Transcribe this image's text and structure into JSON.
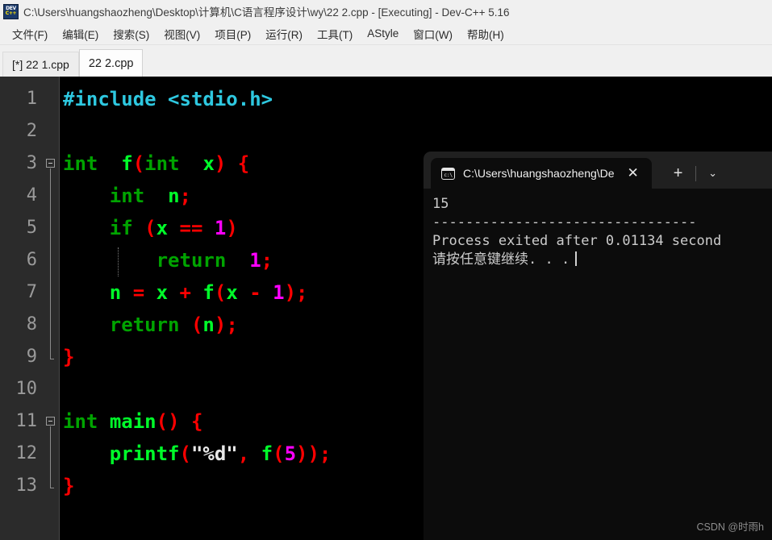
{
  "window": {
    "title": "C:\\Users\\huangshaozheng\\Desktop\\计算机\\C语言程序设计\\wy\\22 2.cpp - [Executing] - Dev-C++ 5.16",
    "icon_dev": "DEV",
    "icon_cpp": "C++"
  },
  "menubar": {
    "items": [
      {
        "label": "文件(F)"
      },
      {
        "label": "编辑(E)"
      },
      {
        "label": "搜索(S)"
      },
      {
        "label": "视图(V)"
      },
      {
        "label": "项目(P)"
      },
      {
        "label": "运行(R)"
      },
      {
        "label": "工具(T)"
      },
      {
        "label": "AStyle"
      },
      {
        "label": "窗口(W)"
      },
      {
        "label": "帮助(H)"
      }
    ]
  },
  "editor_tabs": [
    {
      "label": "[*] 22 1.cpp",
      "active": false
    },
    {
      "label": "22 2.cpp",
      "active": true
    }
  ],
  "editor": {
    "line_numbers": [
      "1",
      "2",
      "3",
      "4",
      "5",
      "6",
      "7",
      "8",
      "9",
      "10",
      "11",
      "12",
      "13"
    ],
    "lines": [
      {
        "n": "1",
        "tokens": [
          {
            "t": "#include ",
            "c": "pre"
          },
          {
            "t": "<stdio.h>",
            "c": "pre"
          }
        ]
      },
      {
        "n": "2",
        "tokens": []
      },
      {
        "n": "3",
        "tokens": [
          {
            "t": "int",
            "c": "kw"
          },
          {
            "t": "  ",
            "c": "op"
          },
          {
            "t": "f",
            "c": "id"
          },
          {
            "t": "(",
            "c": "op"
          },
          {
            "t": "int",
            "c": "kw"
          },
          {
            "t": "  ",
            "c": "op"
          },
          {
            "t": "x",
            "c": "id"
          },
          {
            "t": ")",
            "c": "op"
          },
          {
            "t": " ",
            "c": "op"
          },
          {
            "t": "{",
            "c": "op"
          }
        ]
      },
      {
        "n": "4",
        "tokens": [
          {
            "t": "    ",
            "c": "op"
          },
          {
            "t": "int",
            "c": "kw"
          },
          {
            "t": "  ",
            "c": "op"
          },
          {
            "t": "n",
            "c": "id"
          },
          {
            "t": ";",
            "c": "op"
          }
        ]
      },
      {
        "n": "5",
        "tokens": [
          {
            "t": "    ",
            "c": "op"
          },
          {
            "t": "if",
            "c": "kw"
          },
          {
            "t": " ",
            "c": "op"
          },
          {
            "t": "(",
            "c": "op"
          },
          {
            "t": "x",
            "c": "id"
          },
          {
            "t": " ",
            "c": "op"
          },
          {
            "t": "==",
            "c": "op"
          },
          {
            "t": " ",
            "c": "op"
          },
          {
            "t": "1",
            "c": "num"
          },
          {
            "t": ")",
            "c": "op"
          }
        ]
      },
      {
        "n": "6",
        "tokens": [
          {
            "t": "        ",
            "c": "op"
          },
          {
            "t": "return",
            "c": "kw"
          },
          {
            "t": "  ",
            "c": "op"
          },
          {
            "t": "1",
            "c": "num"
          },
          {
            "t": ";",
            "c": "op"
          }
        ]
      },
      {
        "n": "7",
        "tokens": [
          {
            "t": "    ",
            "c": "op"
          },
          {
            "t": "n",
            "c": "id"
          },
          {
            "t": " ",
            "c": "op"
          },
          {
            "t": "=",
            "c": "op"
          },
          {
            "t": " ",
            "c": "op"
          },
          {
            "t": "x",
            "c": "id"
          },
          {
            "t": " ",
            "c": "op"
          },
          {
            "t": "+",
            "c": "op"
          },
          {
            "t": " ",
            "c": "op"
          },
          {
            "t": "f",
            "c": "id"
          },
          {
            "t": "(",
            "c": "op"
          },
          {
            "t": "x",
            "c": "id"
          },
          {
            "t": " ",
            "c": "op"
          },
          {
            "t": "-",
            "c": "op"
          },
          {
            "t": " ",
            "c": "op"
          },
          {
            "t": "1",
            "c": "num"
          },
          {
            "t": ")",
            "c": "op"
          },
          {
            "t": ";",
            "c": "op"
          }
        ]
      },
      {
        "n": "8",
        "tokens": [
          {
            "t": "    ",
            "c": "op"
          },
          {
            "t": "return",
            "c": "kw"
          },
          {
            "t": " ",
            "c": "op"
          },
          {
            "t": "(",
            "c": "op"
          },
          {
            "t": "n",
            "c": "id"
          },
          {
            "t": ")",
            "c": "op"
          },
          {
            "t": ";",
            "c": "op"
          }
        ]
      },
      {
        "n": "9",
        "tokens": [
          {
            "t": "}",
            "c": "op"
          }
        ]
      },
      {
        "n": "10",
        "tokens": []
      },
      {
        "n": "11",
        "tokens": [
          {
            "t": "int",
            "c": "kw"
          },
          {
            "t": " ",
            "c": "op"
          },
          {
            "t": "main",
            "c": "id"
          },
          {
            "t": "(",
            "c": "op"
          },
          {
            "t": ")",
            "c": "op"
          },
          {
            "t": " ",
            "c": "op"
          },
          {
            "t": "{",
            "c": "op"
          }
        ]
      },
      {
        "n": "12",
        "tokens": [
          {
            "t": "    ",
            "c": "op"
          },
          {
            "t": "printf",
            "c": "id"
          },
          {
            "t": "(",
            "c": "op"
          },
          {
            "t": "\"%d\"",
            "c": "str"
          },
          {
            "t": ",",
            "c": "op"
          },
          {
            "t": " ",
            "c": "op"
          },
          {
            "t": "f",
            "c": "id"
          },
          {
            "t": "(",
            "c": "op"
          },
          {
            "t": "5",
            "c": "num"
          },
          {
            "t": ")",
            "c": "op"
          },
          {
            "t": ")",
            "c": "op"
          },
          {
            "t": ";",
            "c": "op"
          }
        ]
      },
      {
        "n": "13",
        "tokens": [
          {
            "t": "}",
            "c": "op"
          }
        ]
      }
    ]
  },
  "console": {
    "tab_title": "C:\\Users\\huangshaozheng\\De",
    "tab_icon": "cmd-prompt-icon",
    "icon_text": "c:\\",
    "close_label": "✕",
    "newtab_label": "+",
    "chevron_label": "⌄",
    "output_lines": [
      "15",
      "--------------------------------",
      "Process exited after 0.01134 second",
      "请按任意键继续. . ."
    ]
  },
  "watermark": "CSDN @时雨h",
  "colors": {
    "preprocessor": "#2ec8e0",
    "keyword": "#00a400",
    "identifier": "#00ff2a",
    "operator": "#ff0000",
    "number": "#ff00ff",
    "string": "#e8e8e8",
    "editor_bg": "#000000",
    "gutter_bg": "#2b2b2b",
    "console_bg": "#0c0c0c"
  }
}
